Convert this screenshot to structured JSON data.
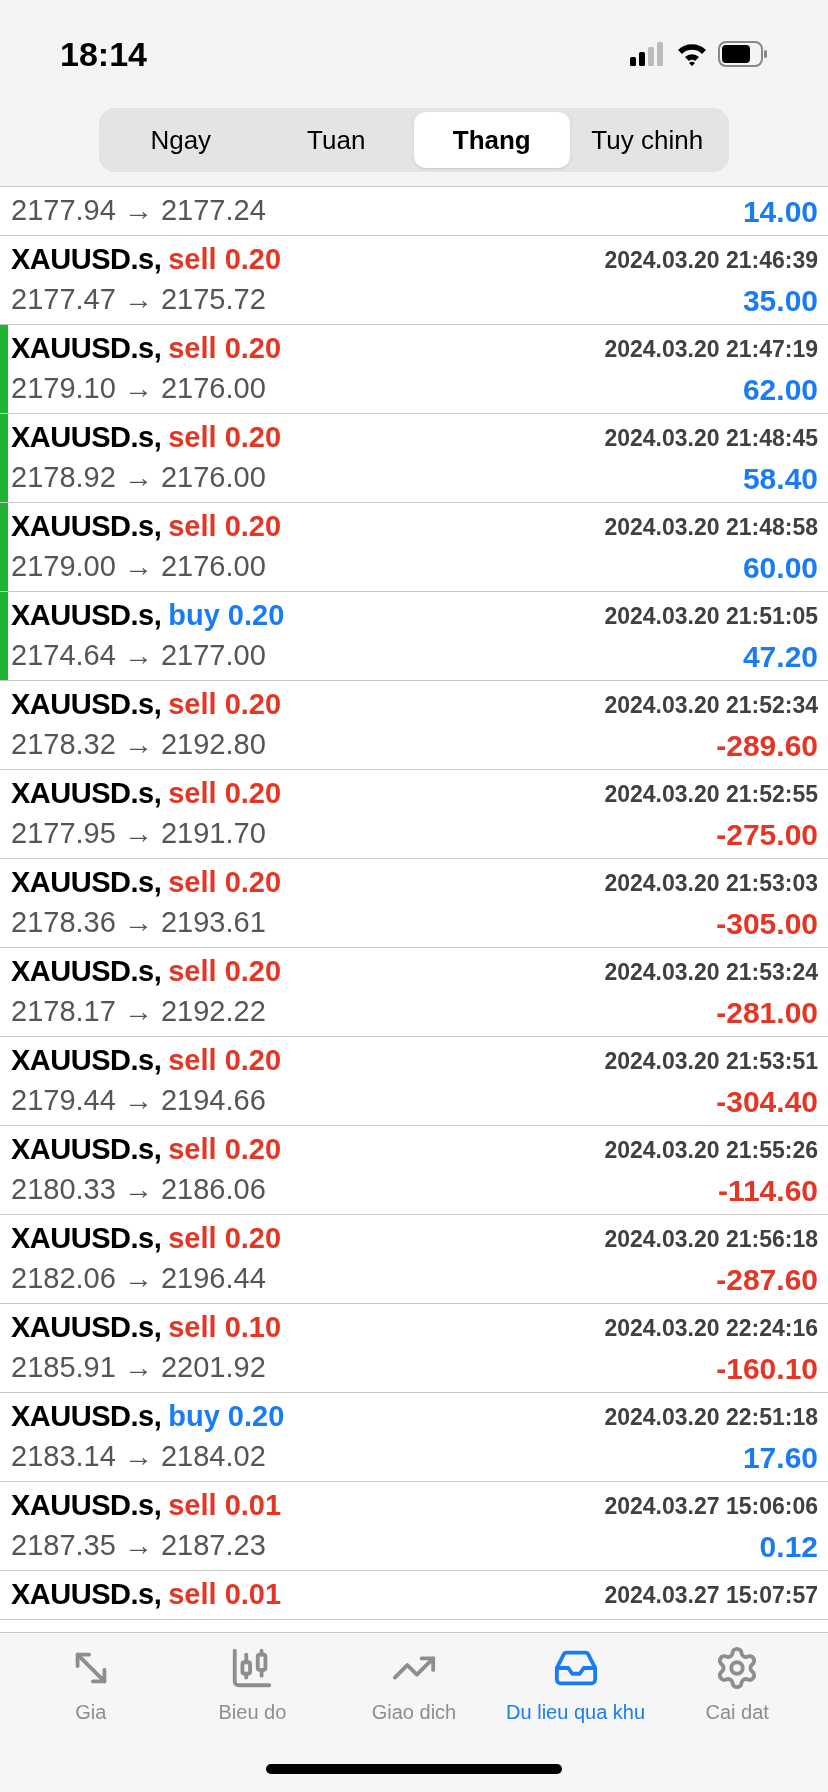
{
  "status_bar": {
    "time": "18:14"
  },
  "period_tabs": [
    {
      "label": "Ngay",
      "selected": false
    },
    {
      "label": "Tuan",
      "selected": false
    },
    {
      "label": "Thang",
      "selected": true
    },
    {
      "label": "Tuy chinh",
      "selected": false
    }
  ],
  "deals": [
    {
      "prices": "2177.94 → 2177.24",
      "profit": "14.00",
      "loss": false,
      "marked": false
    },
    {
      "symbol": "XAUUSD.s,",
      "order": "sell 0.20",
      "buy": false,
      "time": "2024.03.20 21:46:39",
      "prices": "2177.47 → 2175.72",
      "profit": "35.00",
      "loss": false,
      "marked": false
    },
    {
      "symbol": "XAUUSD.s,",
      "order": "sell 0.20",
      "buy": false,
      "time": "2024.03.20 21:47:19",
      "prices": "2179.10 → 2176.00",
      "profit": "62.00",
      "loss": false,
      "marked": true
    },
    {
      "symbol": "XAUUSD.s,",
      "order": "sell 0.20",
      "buy": false,
      "time": "2024.03.20 21:48:45",
      "prices": "2178.92 → 2176.00",
      "profit": "58.40",
      "loss": false,
      "marked": true
    },
    {
      "symbol": "XAUUSD.s,",
      "order": "sell 0.20",
      "buy": false,
      "time": "2024.03.20 21:48:58",
      "prices": "2179.00 → 2176.00",
      "profit": "60.00",
      "loss": false,
      "marked": true
    },
    {
      "symbol": "XAUUSD.s,",
      "order": "buy 0.20",
      "buy": true,
      "time": "2024.03.20 21:51:05",
      "prices": "2174.64 → 2177.00",
      "profit": "47.20",
      "loss": false,
      "marked": true
    },
    {
      "symbol": "XAUUSD.s,",
      "order": "sell 0.20",
      "buy": false,
      "time": "2024.03.20 21:52:34",
      "prices": "2178.32 → 2192.80",
      "profit": "-289.60",
      "loss": true,
      "marked": false
    },
    {
      "symbol": "XAUUSD.s,",
      "order": "sell 0.20",
      "buy": false,
      "time": "2024.03.20 21:52:55",
      "prices": "2177.95 → 2191.70",
      "profit": "-275.00",
      "loss": true,
      "marked": false
    },
    {
      "symbol": "XAUUSD.s,",
      "order": "sell 0.20",
      "buy": false,
      "time": "2024.03.20 21:53:03",
      "prices": "2178.36 → 2193.61",
      "profit": "-305.00",
      "loss": true,
      "marked": false
    },
    {
      "symbol": "XAUUSD.s,",
      "order": "sell 0.20",
      "buy": false,
      "time": "2024.03.20 21:53:24",
      "prices": "2178.17 → 2192.22",
      "profit": "-281.00",
      "loss": true,
      "marked": false
    },
    {
      "symbol": "XAUUSD.s,",
      "order": "sell 0.20",
      "buy": false,
      "time": "2024.03.20 21:53:51",
      "prices": "2179.44 → 2194.66",
      "profit": "-304.40",
      "loss": true,
      "marked": false
    },
    {
      "symbol": "XAUUSD.s,",
      "order": "sell 0.20",
      "buy": false,
      "time": "2024.03.20 21:55:26",
      "prices": "2180.33 → 2186.06",
      "profit": "-114.60",
      "loss": true,
      "marked": false
    },
    {
      "symbol": "XAUUSD.s,",
      "order": "sell 0.20",
      "buy": false,
      "time": "2024.03.20 21:56:18",
      "prices": "2182.06 → 2196.44",
      "profit": "-287.60",
      "loss": true,
      "marked": false
    },
    {
      "symbol": "XAUUSD.s,",
      "order": "sell 0.10",
      "buy": false,
      "time": "2024.03.20 22:24:16",
      "prices": "2185.91 → 2201.92",
      "profit": "-160.10",
      "loss": true,
      "marked": false
    },
    {
      "symbol": "XAUUSD.s,",
      "order": "buy 0.20",
      "buy": true,
      "time": "2024.03.20 22:51:18",
      "prices": "2183.14 → 2184.02",
      "profit": "17.60",
      "loss": false,
      "marked": false
    },
    {
      "symbol": "XAUUSD.s,",
      "order": "sell 0.01",
      "buy": false,
      "time": "2024.03.27 15:06:06",
      "prices": "2187.35 → 2187.23",
      "profit": "0.12",
      "loss": false,
      "marked": false
    },
    {
      "symbol": "XAUUSD.s,",
      "order": "sell 0.01",
      "buy": false,
      "time": "2024.03.27 15:07:57",
      "marked": false
    }
  ],
  "tab_bar": [
    {
      "kind": "quotes",
      "label": "Gia",
      "selected": false
    },
    {
      "kind": "chart",
      "label": "Bieu do",
      "selected": false
    },
    {
      "kind": "trade",
      "label": "Giao dich",
      "selected": false
    },
    {
      "kind": "history",
      "label": "Du lieu qua khu",
      "selected": true
    },
    {
      "kind": "settings",
      "label": "Cai dat",
      "selected": false
    }
  ]
}
